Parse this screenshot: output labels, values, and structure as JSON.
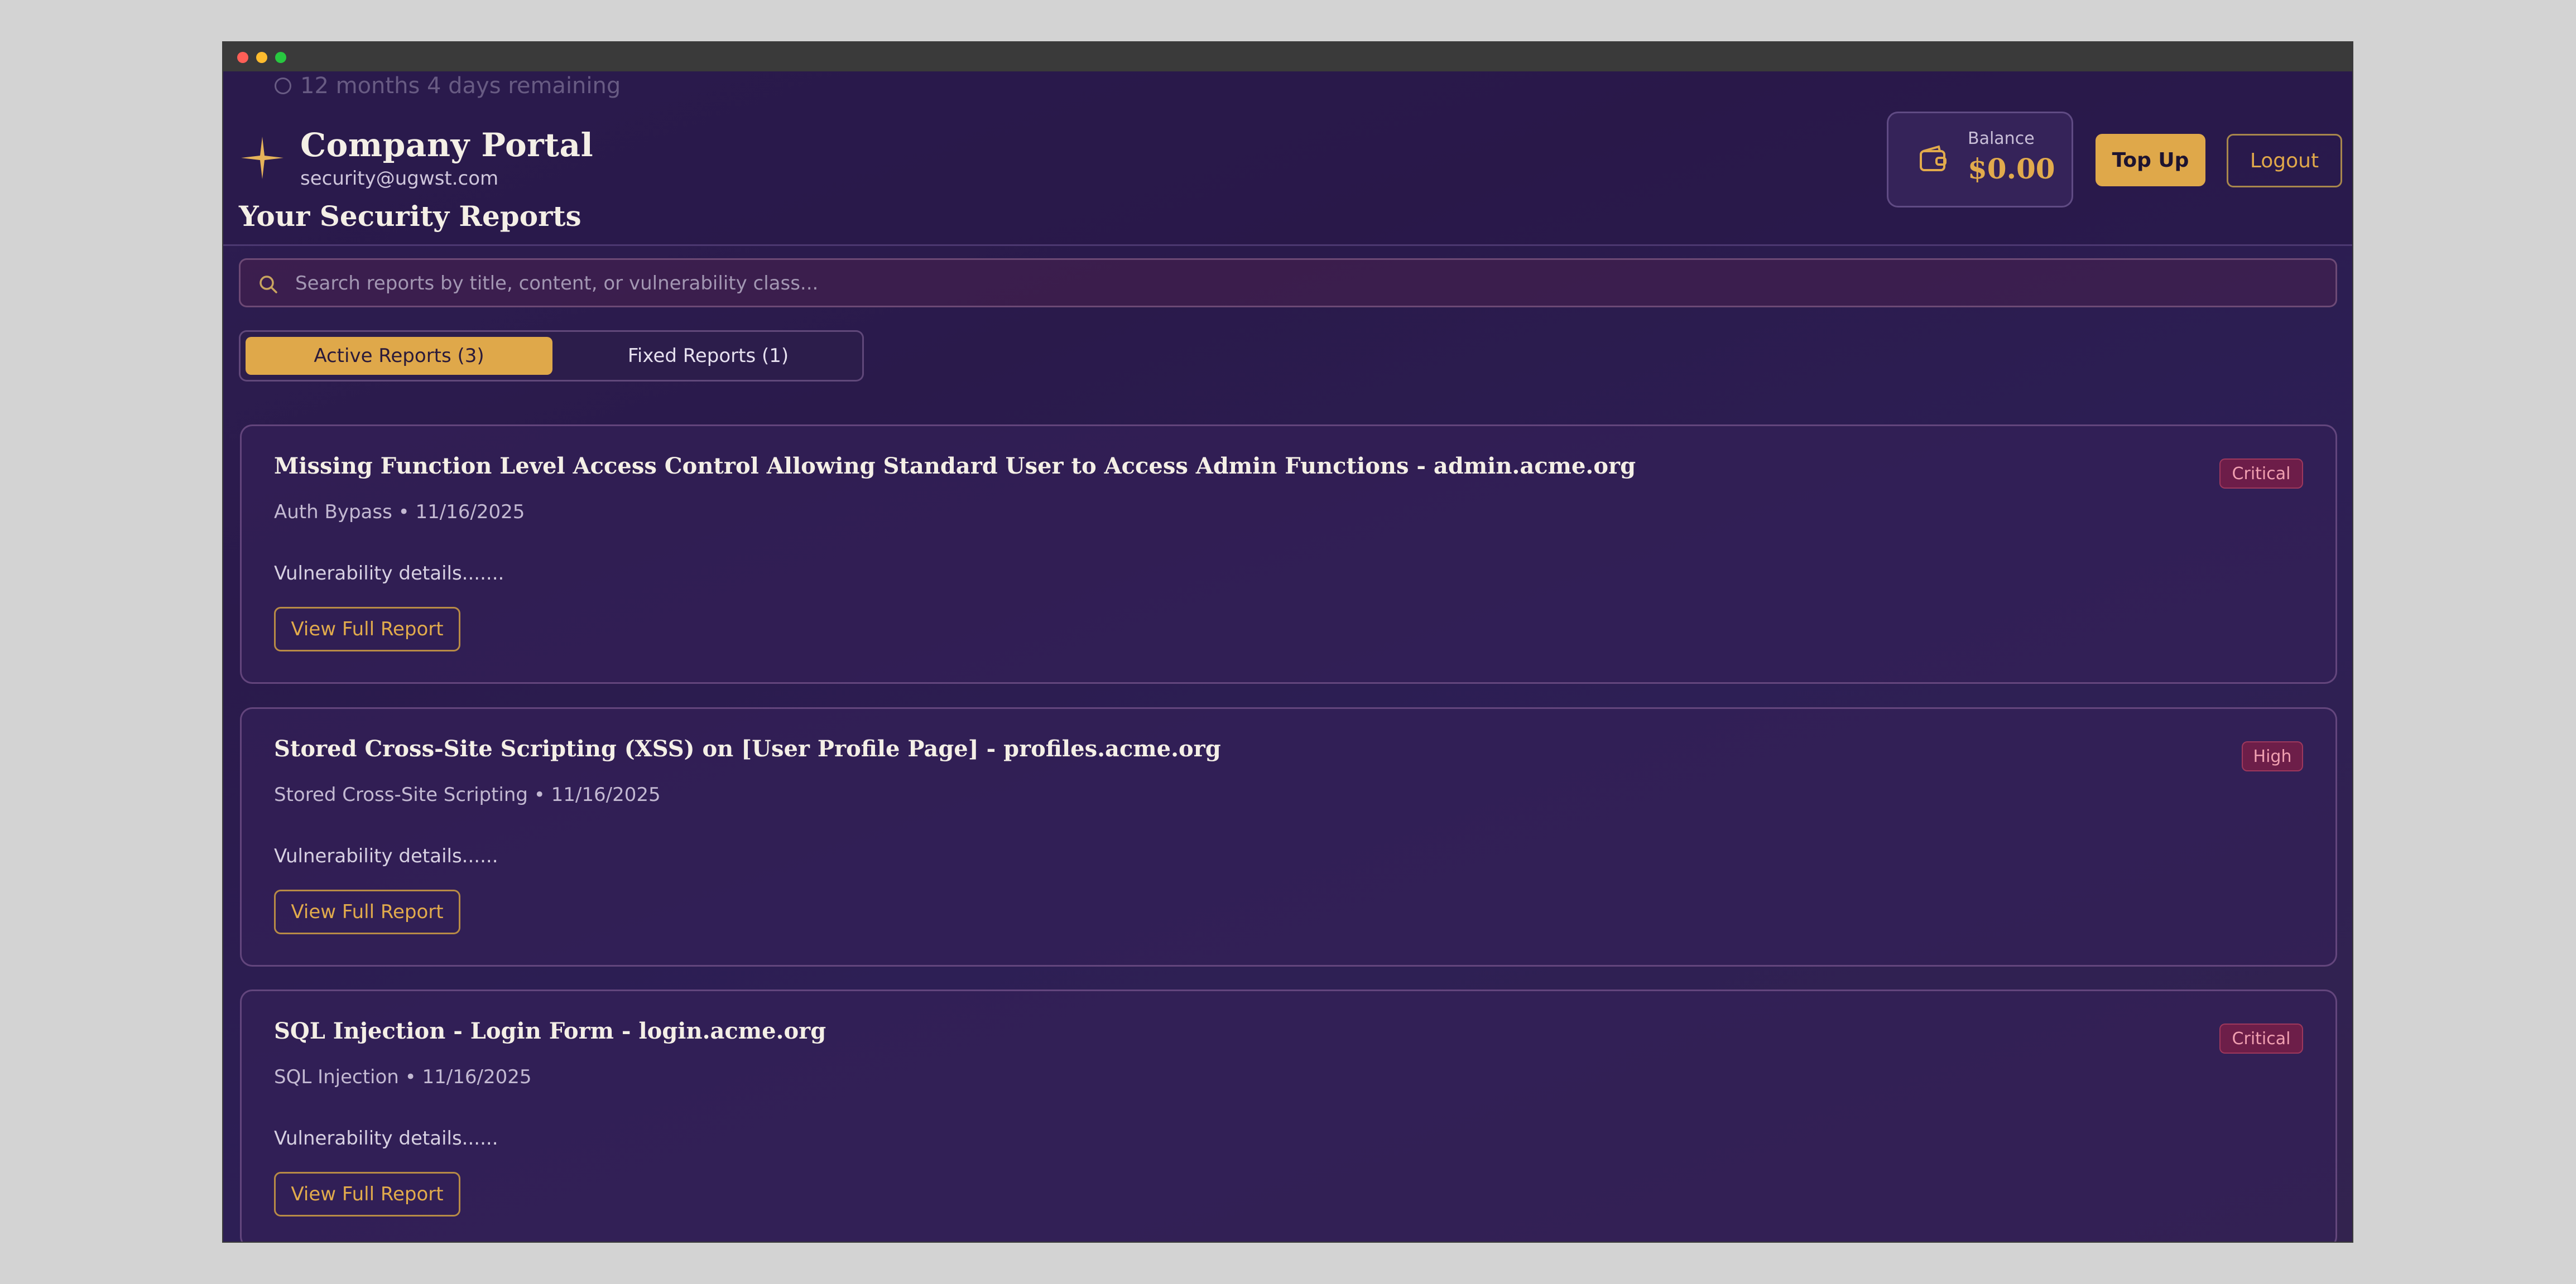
{
  "header": {
    "remaining_text": "12 months 4 days remaining",
    "portal_title": "Company Portal",
    "email": "security@ugwst.com",
    "balance_label": "Balance",
    "balance_value": "$0.00",
    "topup_label": "Top Up",
    "logout_label": "Logout"
  },
  "main": {
    "section_title": "Your Security Reports",
    "search_placeholder": "Search reports by title, content, or vulnerability class...",
    "tabs": [
      {
        "label": "Active Reports (3)",
        "active": true
      },
      {
        "label": "Fixed Reports (1)",
        "active": false
      }
    ],
    "reports": [
      {
        "title": "Missing Function Level Access Control Allowing Standard User to Access Admin Functions - admin.acme.org",
        "meta": "Auth Bypass • 11/16/2025",
        "details": "Vulnerability details.......",
        "severity": "Critical",
        "view_label": "View Full Report"
      },
      {
        "title": "Stored Cross-Site Scripting (XSS) on [User Profile Page] - profiles.acme.org",
        "meta": "Stored Cross-Site Scripting • 11/16/2025",
        "details": "Vulnerability details......",
        "severity": "High",
        "view_label": "View Full Report"
      },
      {
        "title": "SQL Injection - Login Form - login.acme.org",
        "meta": "SQL Injection • 11/16/2025",
        "details": "Vulnerability details......",
        "severity": "Critical",
        "view_label": "View Full Report"
      }
    ]
  },
  "colors": {
    "accent": "#dfa84a",
    "background": "#2a1a4b",
    "badge_text": "#f1a0b1"
  },
  "icons": {
    "logo": "sparkle-icon",
    "balance": "wallet-icon",
    "search": "search-icon",
    "remaining": "clock-icon"
  }
}
